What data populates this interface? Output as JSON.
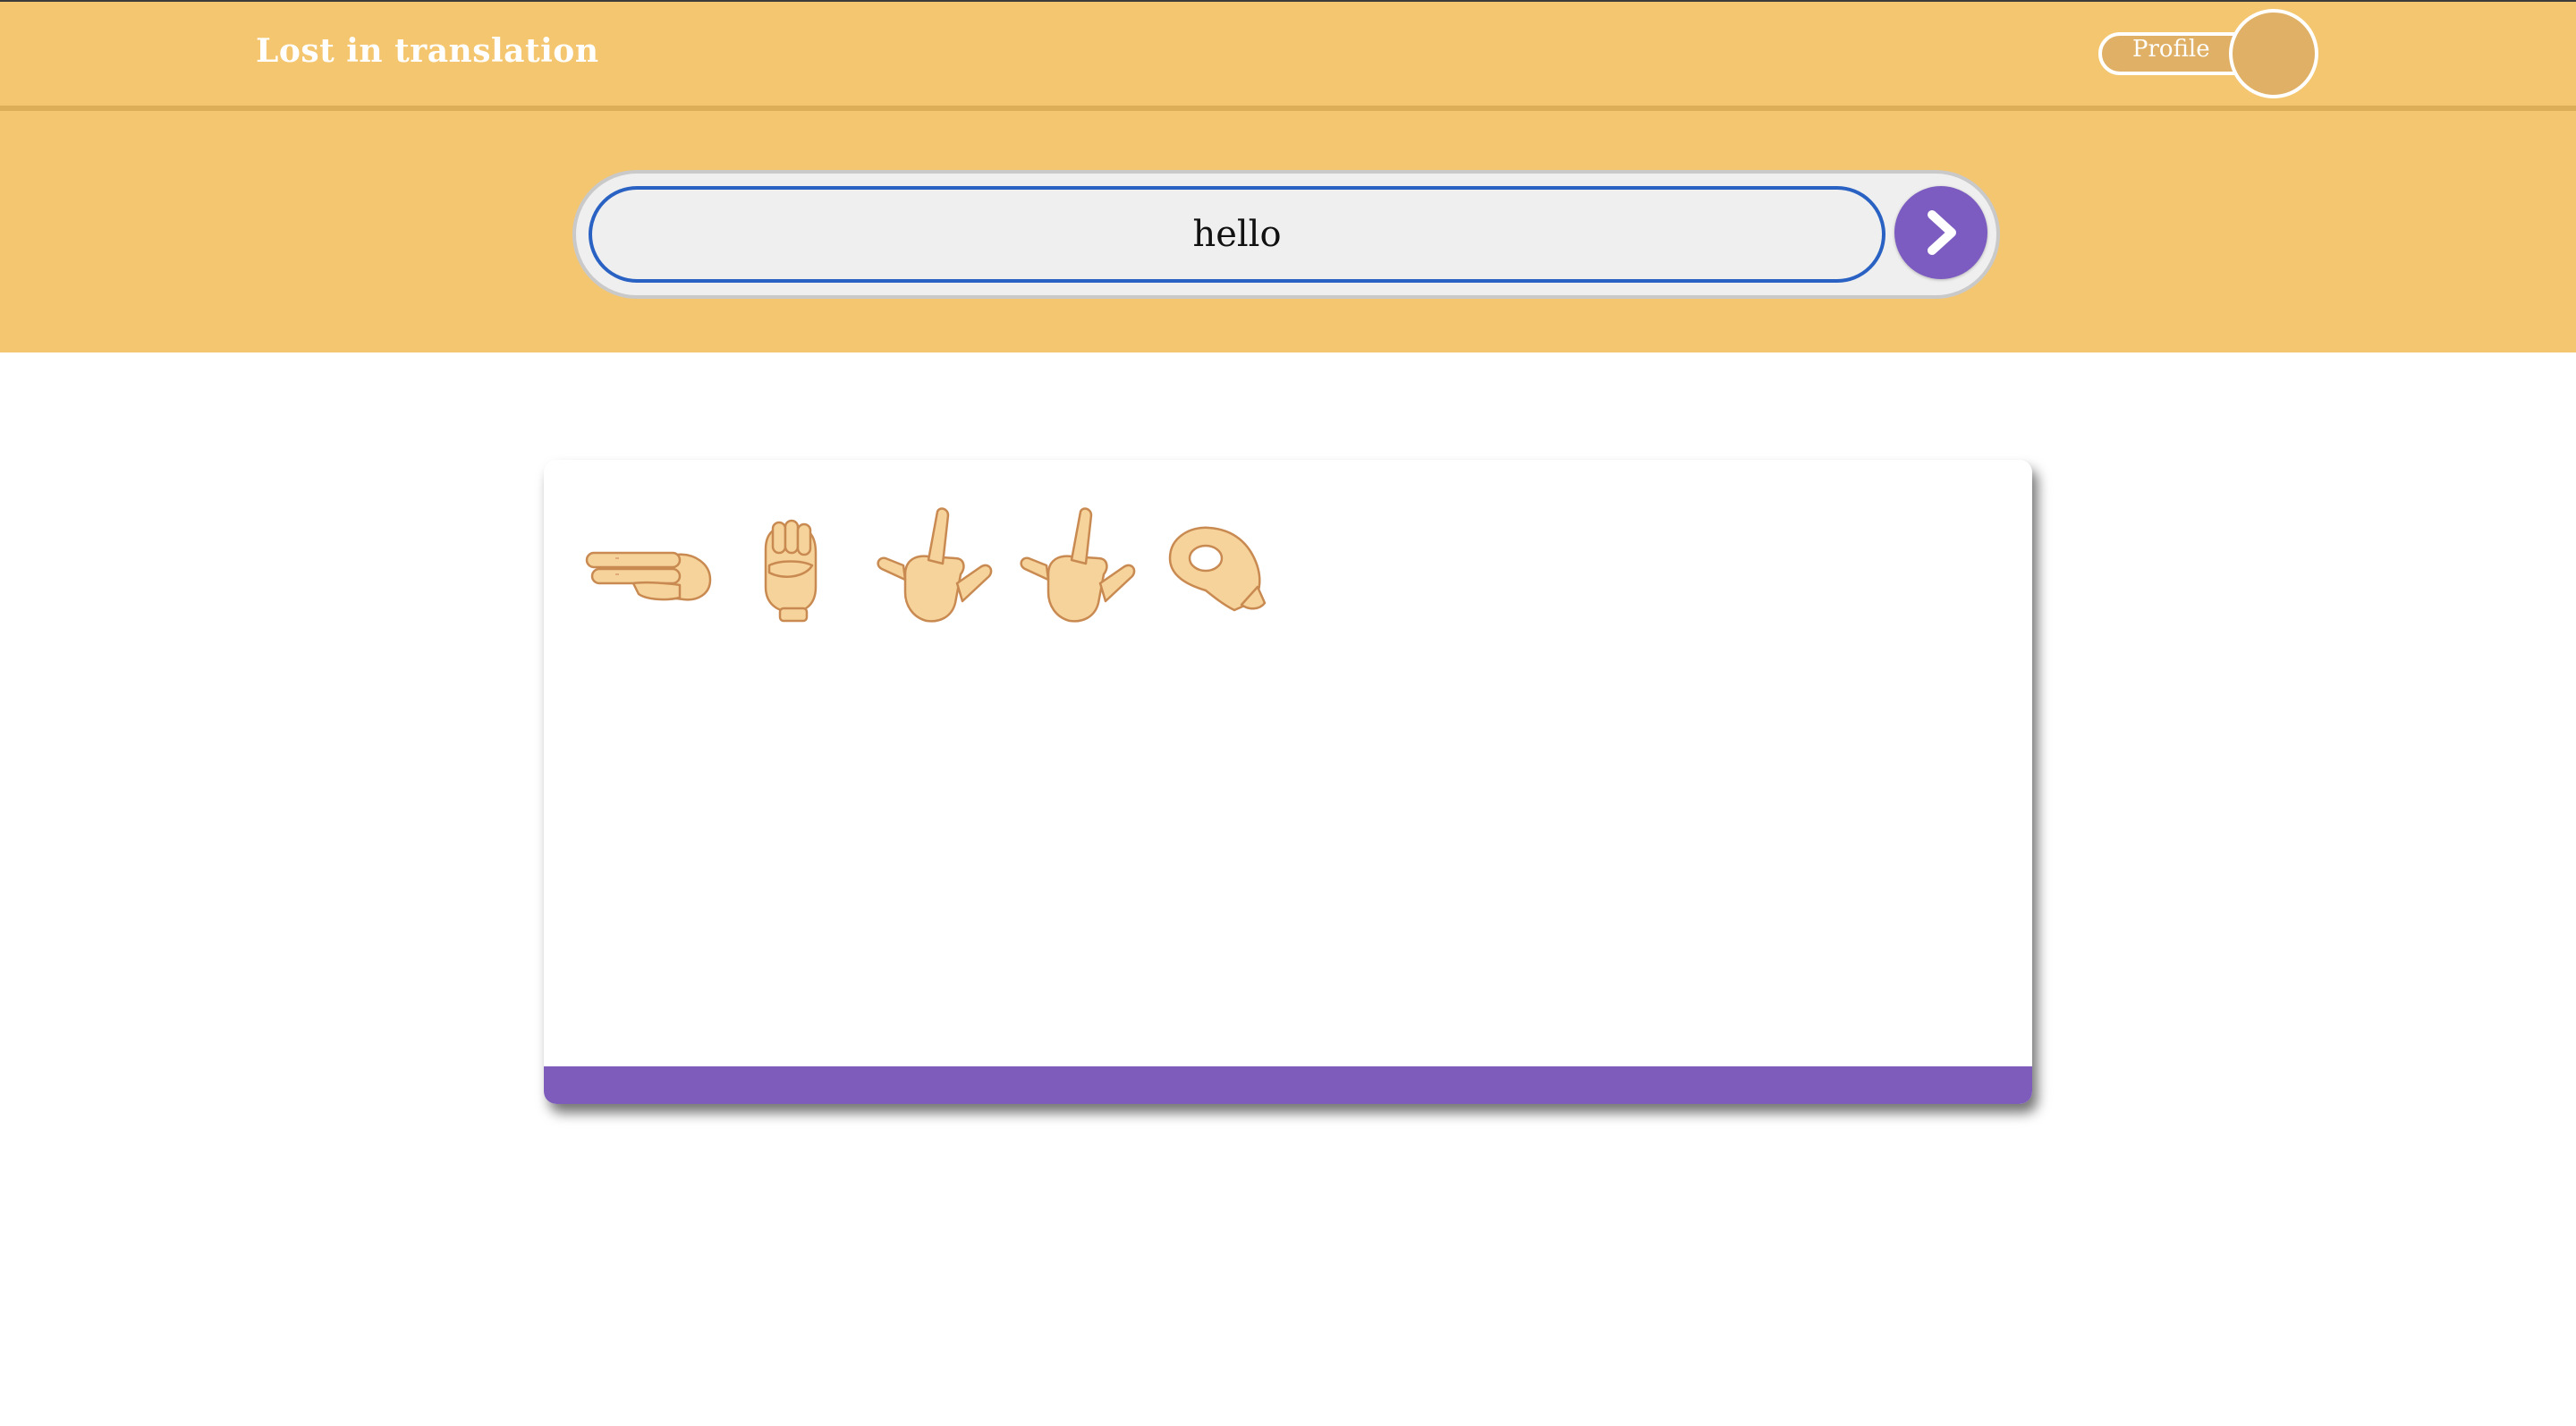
{
  "header": {
    "brand": "Lost in translation",
    "profile_label": "Profile"
  },
  "search": {
    "value": "hello",
    "placeholder": ""
  },
  "translation": {
    "letters": [
      "h",
      "e",
      "l",
      "l",
      "o"
    ],
    "icons": [
      "hand-sign-h-icon",
      "hand-sign-e-icon",
      "hand-sign-l-icon",
      "hand-sign-l-icon",
      "hand-sign-o-icon"
    ]
  },
  "colors": {
    "header_bg": "#f4c670",
    "accent": "#7e5cbc",
    "input_border": "#2a62c4",
    "skin": "#f6d39a"
  }
}
